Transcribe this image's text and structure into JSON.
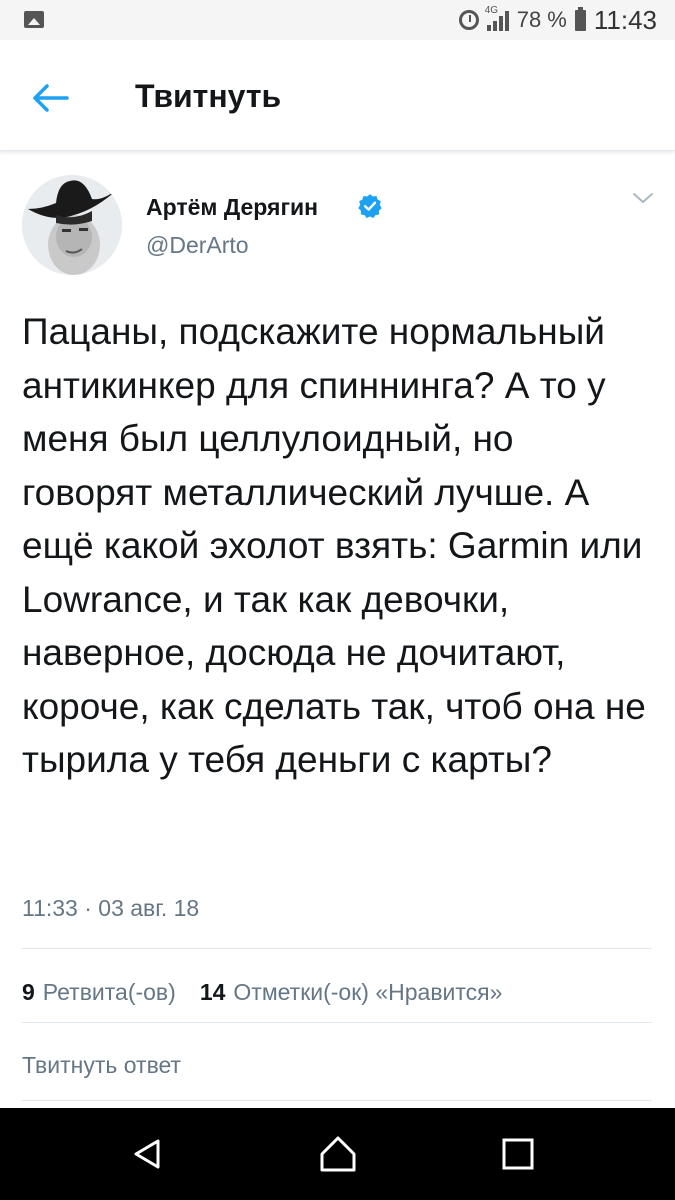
{
  "status_bar": {
    "network": "4G",
    "battery": "78 %",
    "time": "11:43",
    "icons": [
      "gallery-icon",
      "alarm-icon",
      "signal-icon",
      "battery-icon"
    ]
  },
  "header": {
    "title": "Твитнуть",
    "back_icon": "arrow-left-icon"
  },
  "tweet": {
    "author": {
      "name": "Артём Дерягин",
      "handle": "@DerArto",
      "verified": true
    },
    "text": "Пацаны, подскажите нормальный антикинкер для спиннинга? А то у меня был целлулоидный, но говорят металлический лучше. А ещё какой эхолот взять: Garmin или Lowrance, и так как девочки, наверное, досюда не дочитают, короче, как сделать так, чтоб она не тырила у тебя деньги с карты?",
    "timestamp": "11:33 · 03 авг. 18",
    "retweets_count": "9",
    "retweets_label": "Ретвита(-ов)",
    "likes_count": "14",
    "likes_label": "Отметки(-ок) «Нравится»"
  },
  "reply": {
    "placeholder": "Твитнуть ответ"
  },
  "colors": {
    "accent": "#1da1f2",
    "text": "#14171a",
    "secondary": "#657786",
    "divider": "#e1e8ed",
    "navbar": "#000000"
  },
  "navbar": {
    "icons": [
      "back-triangle-icon",
      "home-icon",
      "recents-icon"
    ]
  }
}
